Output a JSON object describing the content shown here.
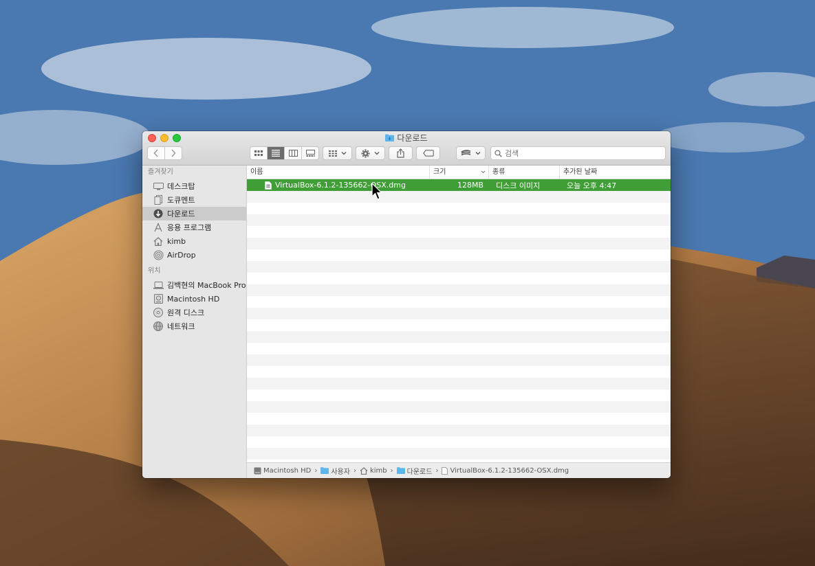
{
  "window": {
    "title": "다운로드"
  },
  "toolbar": {
    "search_placeholder": "검색",
    "icons": [
      "back-icon",
      "forward-icon",
      "icon-view-icon",
      "list-view-icon",
      "column-view-icon",
      "gallery-view-icon",
      "group-icon",
      "gear-icon",
      "share-icon",
      "tag-icon",
      "dropbox-icon"
    ]
  },
  "sidebar": {
    "favorites_header": "즐겨찾기",
    "favorites": [
      {
        "label": "데스크탑",
        "icon": "desktop-icon"
      },
      {
        "label": "도큐멘트",
        "icon": "documents-icon"
      },
      {
        "label": "다운로드",
        "icon": "downloads-icon"
      },
      {
        "label": "응용 프로그램",
        "icon": "applications-icon"
      },
      {
        "label": "kimb",
        "icon": "home-icon"
      },
      {
        "label": "AirDrop",
        "icon": "airdrop-icon"
      }
    ],
    "locations_header": "위치",
    "locations": [
      {
        "label": "김백현의 MacBook Pro",
        "icon": "laptop-icon"
      },
      {
        "label": "Macintosh HD",
        "icon": "disk-icon"
      },
      {
        "label": "원격 디스크",
        "icon": "remote-disc-icon"
      },
      {
        "label": "네트워크",
        "icon": "network-icon"
      }
    ]
  },
  "columns": {
    "name": "이름",
    "size": "크기",
    "kind": "종류",
    "date_added": "추가된 날짜"
  },
  "files": [
    {
      "name": "VirtualBox-6.1.2-135662-OSX.dmg",
      "size": "128MB",
      "kind": "디스크 이미지",
      "date_added": "오늘 오후 4:47"
    }
  ],
  "pathbar": [
    "Macintosh HD",
    "사용자",
    "kimb",
    "다운로드",
    "VirtualBox-6.1.2-135662-OSX.dmg"
  ],
  "colors": {
    "selection": "#3f9e35",
    "sidebar_selected": "#cbcbcb"
  }
}
